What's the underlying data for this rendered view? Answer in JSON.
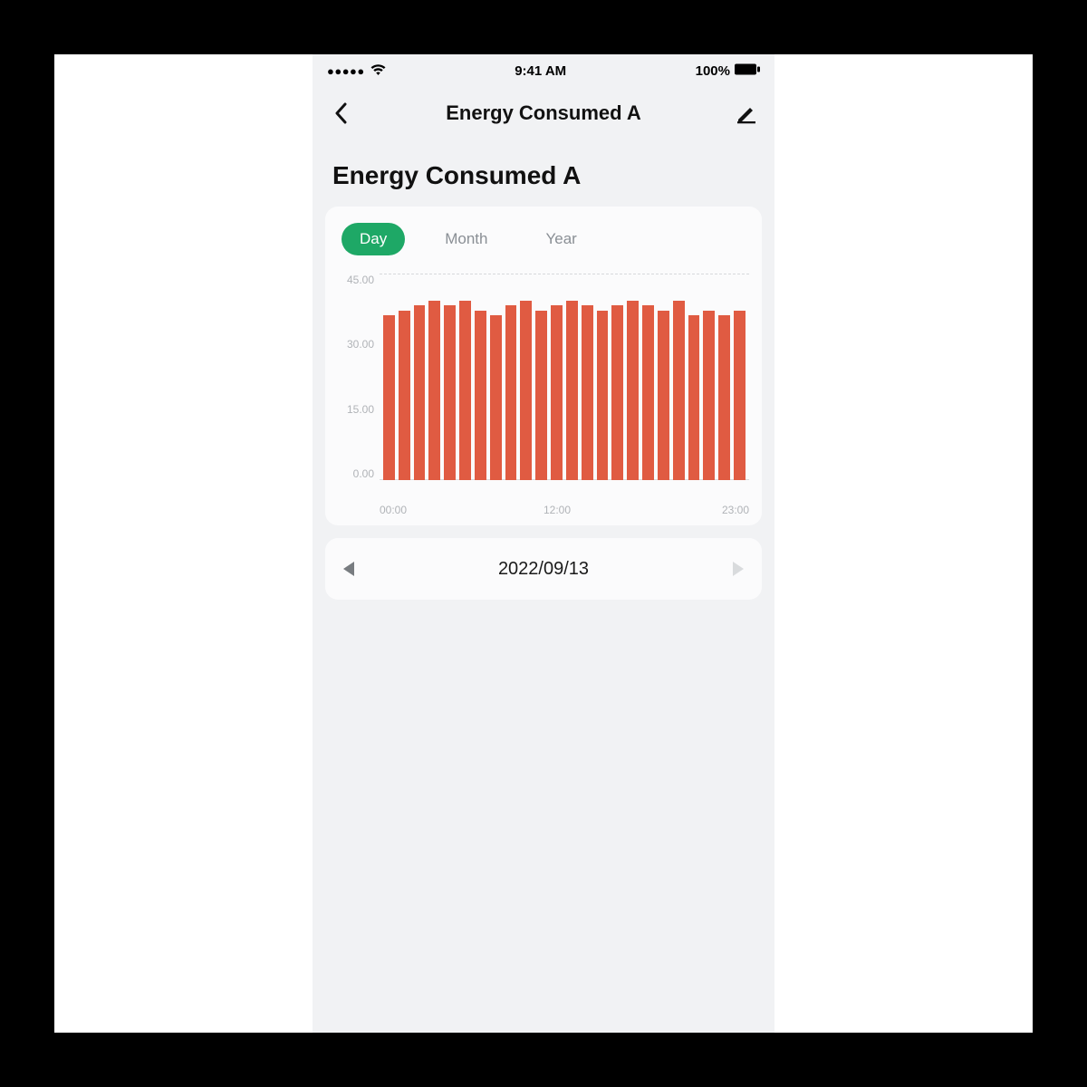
{
  "statusbar": {
    "signal_dots": "●●●●●",
    "time": "9:41 AM",
    "battery_pct": "100%"
  },
  "header": {
    "title": "Energy Consumed A"
  },
  "page": {
    "heading": "Energy Consumed A"
  },
  "tabs": {
    "items": [
      {
        "label": "Day",
        "active": true
      },
      {
        "label": "Month",
        "active": false
      },
      {
        "label": "Year",
        "active": false
      }
    ]
  },
  "date_picker": {
    "date": "2022/09/13",
    "prev_enabled": true,
    "next_enabled": false
  },
  "colors": {
    "accent_green": "#1ea866",
    "bar_color": "#e05b42"
  },
  "chart_data": {
    "type": "bar",
    "title": "",
    "xlabel": "",
    "ylabel": "",
    "ylim": [
      0,
      45
    ],
    "y_ticks": [
      "45.00",
      "30.00",
      "15.00",
      "0.00"
    ],
    "x_ticks": [
      "00:00",
      "12:00",
      "23:00"
    ],
    "categories": [
      "00",
      "01",
      "02",
      "03",
      "04",
      "05",
      "06",
      "07",
      "08",
      "09",
      "10",
      "11",
      "12",
      "13",
      "14",
      "15",
      "16",
      "17",
      "18",
      "19",
      "20",
      "21",
      "22",
      "23"
    ],
    "values": [
      36,
      37,
      38,
      39,
      38,
      39,
      37,
      36,
      38,
      39,
      37,
      38,
      39,
      38,
      37,
      38,
      39,
      38,
      37,
      39,
      36,
      37,
      36,
      37
    ]
  }
}
